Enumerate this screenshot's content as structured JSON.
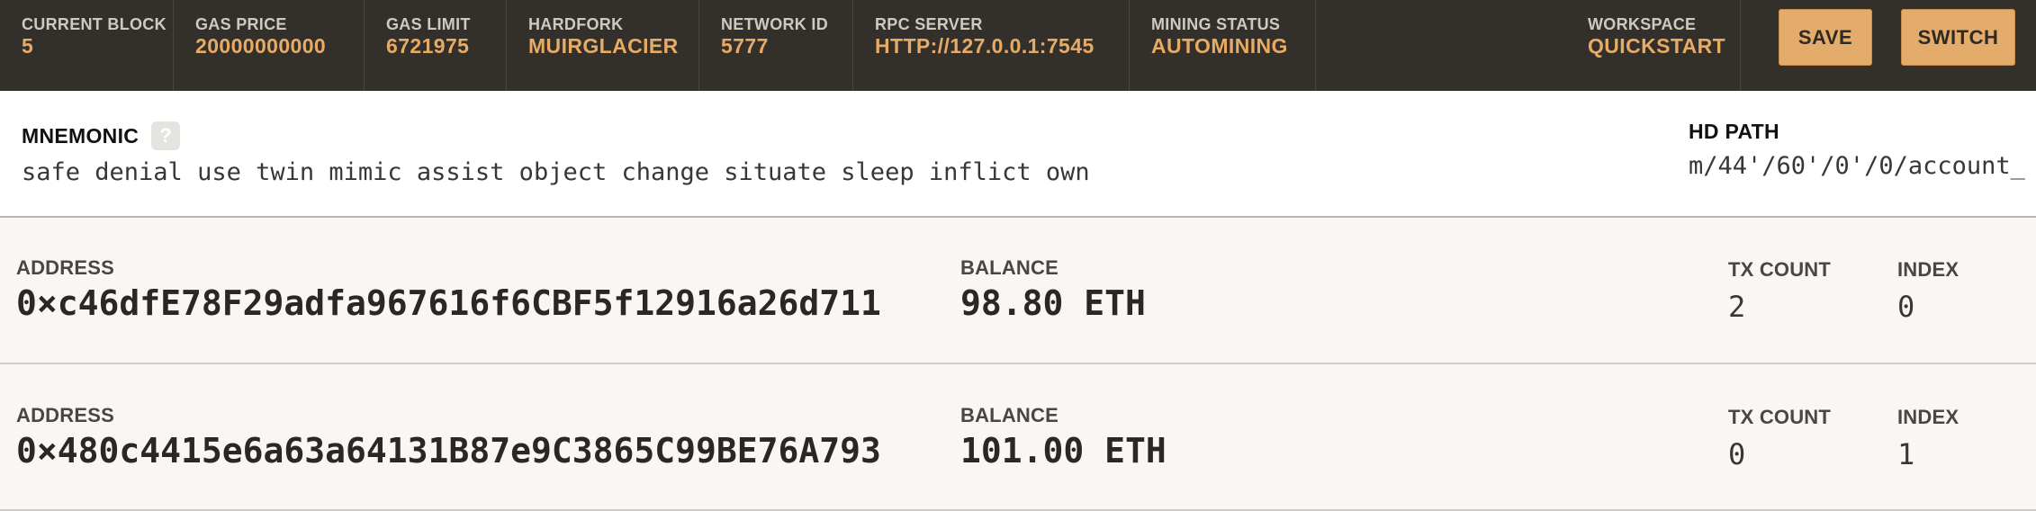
{
  "status": {
    "current_block": {
      "label": "CURRENT BLOCK",
      "value": "5"
    },
    "gas_price": {
      "label": "GAS PRICE",
      "value": "20000000000"
    },
    "gas_limit": {
      "label": "GAS LIMIT",
      "value": "6721975"
    },
    "hardfork": {
      "label": "HARDFORK",
      "value": "MUIRGLACIER"
    },
    "network_id": {
      "label": "NETWORK ID",
      "value": "5777"
    },
    "rpc_server": {
      "label": "RPC SERVER",
      "value": "HTTP://127.0.0.1:7545"
    },
    "mining_status": {
      "label": "MINING STATUS",
      "value": "AUTOMINING"
    },
    "workspace": {
      "label": "WORKSPACE",
      "value": "QUICKSTART"
    }
  },
  "buttons": {
    "save": "SAVE",
    "switch": "SWITCH"
  },
  "mnemonic": {
    "title": "MNEMONIC",
    "help_glyph": "?",
    "help_icon": "question-mark-icon",
    "words": "safe denial use twin mimic assist object change situate sleep inflict own"
  },
  "hd_path": {
    "title": "HD PATH",
    "value": "m/44'/60'/0'/0/account_"
  },
  "accounts": [
    {
      "address_label": "ADDRESS",
      "address": "0×c46dfE78F29adfa967616f6CBF5f12916a26d711",
      "balance_label": "BALANCE",
      "balance": "98.80 ETH",
      "tx_count_label": "TX COUNT",
      "tx_count": "2",
      "index_label": "INDEX",
      "index": "0"
    },
    {
      "address_label": "ADDRESS",
      "address": "0×480c4415e6a63a64131B87e9C3865C99BE76A793",
      "balance_label": "BALANCE",
      "balance": "101.00 ETH",
      "tx_count_label": "TX COUNT",
      "tx_count": "0",
      "index_label": "INDEX",
      "index": "1"
    }
  ],
  "colors": {
    "header_bg": "#33302b",
    "accent": "#e7ab65",
    "button_bg": "#e3ac6a"
  }
}
